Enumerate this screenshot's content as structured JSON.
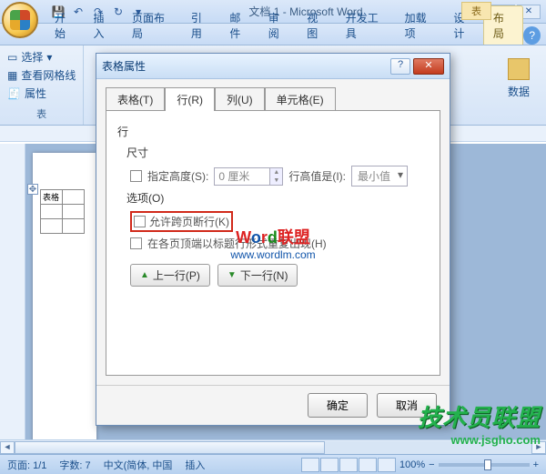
{
  "title": "文档 1 - Microsoft Word",
  "contextual_title": "表",
  "qat_tips": [
    "save",
    "undo",
    "redo",
    "repeat",
    "more"
  ],
  "ribbon_tabs": [
    "开始",
    "插入",
    "页面布局",
    "引用",
    "邮件",
    "审阅",
    "视图",
    "开发工具",
    "加载项",
    "设计",
    "布局"
  ],
  "ribbon_active_index": 10,
  "ribbon_group_left": {
    "select_label": "选择",
    "view_grid": "查看网格线",
    "properties": "属性",
    "footer": "表"
  },
  "ribbon_right_btn": "数据",
  "dialog": {
    "title": "表格属性",
    "tabs": [
      "表格(T)",
      "行(R)",
      "列(U)",
      "单元格(E)"
    ],
    "active_tab_index": 1,
    "row_heading": "行",
    "size_heading": "尺寸",
    "specify_height_label": "指定高度(S):",
    "height_value": "0 厘米",
    "row_height_is": "行高值是(I):",
    "row_height_mode": "最小值",
    "options_heading": "选项(O)",
    "allow_break": "允许跨页断行(K)",
    "repeat_header": "在各页顶端以标题行形式重复出现(H)",
    "prev_row": "上一行(P)",
    "next_row": "下一行(N)",
    "ok": "确定",
    "cancel": "取消"
  },
  "watermark": {
    "brand": "Word联盟",
    "url": "www.wordlm.com"
  },
  "corner_brand": {
    "l1": "技术员联盟",
    "l2": "www.jsgho.com"
  },
  "table_in_doc": {
    "label": "表格"
  },
  "status": {
    "page": "页面: 1/1",
    "words": "字数: 7",
    "lang": "中文(简体, 中国",
    "insert": "插入",
    "zoom": "100%"
  }
}
